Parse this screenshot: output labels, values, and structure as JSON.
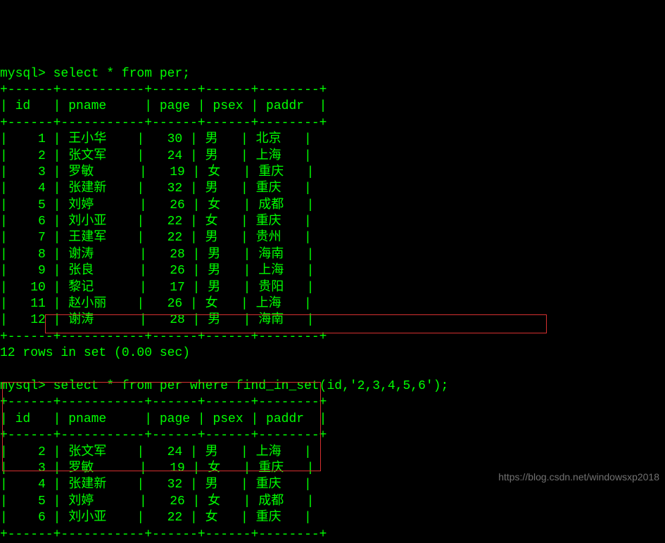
{
  "prompt": "mysql>",
  "query1": " select * from per;",
  "query2": " select * from per where find_in_set(id,'2,3,4,5,6');",
  "columns": [
    "id",
    "pname",
    "page",
    "psex",
    "paddr"
  ],
  "table1": {
    "rows": [
      {
        "id": 1,
        "pname": "王小华",
        "page": 30,
        "psex": "男",
        "paddr": "北京"
      },
      {
        "id": 2,
        "pname": "张文军",
        "page": 24,
        "psex": "男",
        "paddr": "上海"
      },
      {
        "id": 3,
        "pname": "罗敏",
        "page": 19,
        "psex": "女",
        "paddr": "重庆"
      },
      {
        "id": 4,
        "pname": "张建新",
        "page": 32,
        "psex": "男",
        "paddr": "重庆"
      },
      {
        "id": 5,
        "pname": "刘婷",
        "page": 26,
        "psex": "女",
        "paddr": "成都"
      },
      {
        "id": 6,
        "pname": "刘小亚",
        "page": 22,
        "psex": "女",
        "paddr": "重庆"
      },
      {
        "id": 7,
        "pname": "王建军",
        "page": 22,
        "psex": "男",
        "paddr": "贵州"
      },
      {
        "id": 8,
        "pname": "谢涛",
        "page": 28,
        "psex": "男",
        "paddr": "海南"
      },
      {
        "id": 9,
        "pname": "张良",
        "page": 26,
        "psex": "男",
        "paddr": "上海"
      },
      {
        "id": 10,
        "pname": "黎记",
        "page": 17,
        "psex": "男",
        "paddr": "贵阳"
      },
      {
        "id": 11,
        "pname": "赵小丽",
        "page": 26,
        "psex": "女",
        "paddr": "上海"
      },
      {
        "id": 12,
        "pname": "谢涛",
        "page": 28,
        "psex": "男",
        "paddr": "海南"
      }
    ]
  },
  "result1_footer": "12 rows in set (0.00 sec)",
  "table2": {
    "rows": [
      {
        "id": 2,
        "pname": "张文军",
        "page": 24,
        "psex": "男",
        "paddr": "上海"
      },
      {
        "id": 3,
        "pname": "罗敏",
        "page": 19,
        "psex": "女",
        "paddr": "重庆"
      },
      {
        "id": 4,
        "pname": "张建新",
        "page": 32,
        "psex": "男",
        "paddr": "重庆"
      },
      {
        "id": 5,
        "pname": "刘婷",
        "page": 26,
        "psex": "女",
        "paddr": "成都"
      },
      {
        "id": 6,
        "pname": "刘小亚",
        "page": 22,
        "psex": "女",
        "paddr": "重庆"
      }
    ]
  },
  "border": "+------+-----------+------+------+--------+",
  "header_row": "| id   | pname     | page | psex | paddr  |",
  "watermark": "https://blog.csdn.net/windowsxp2018"
}
